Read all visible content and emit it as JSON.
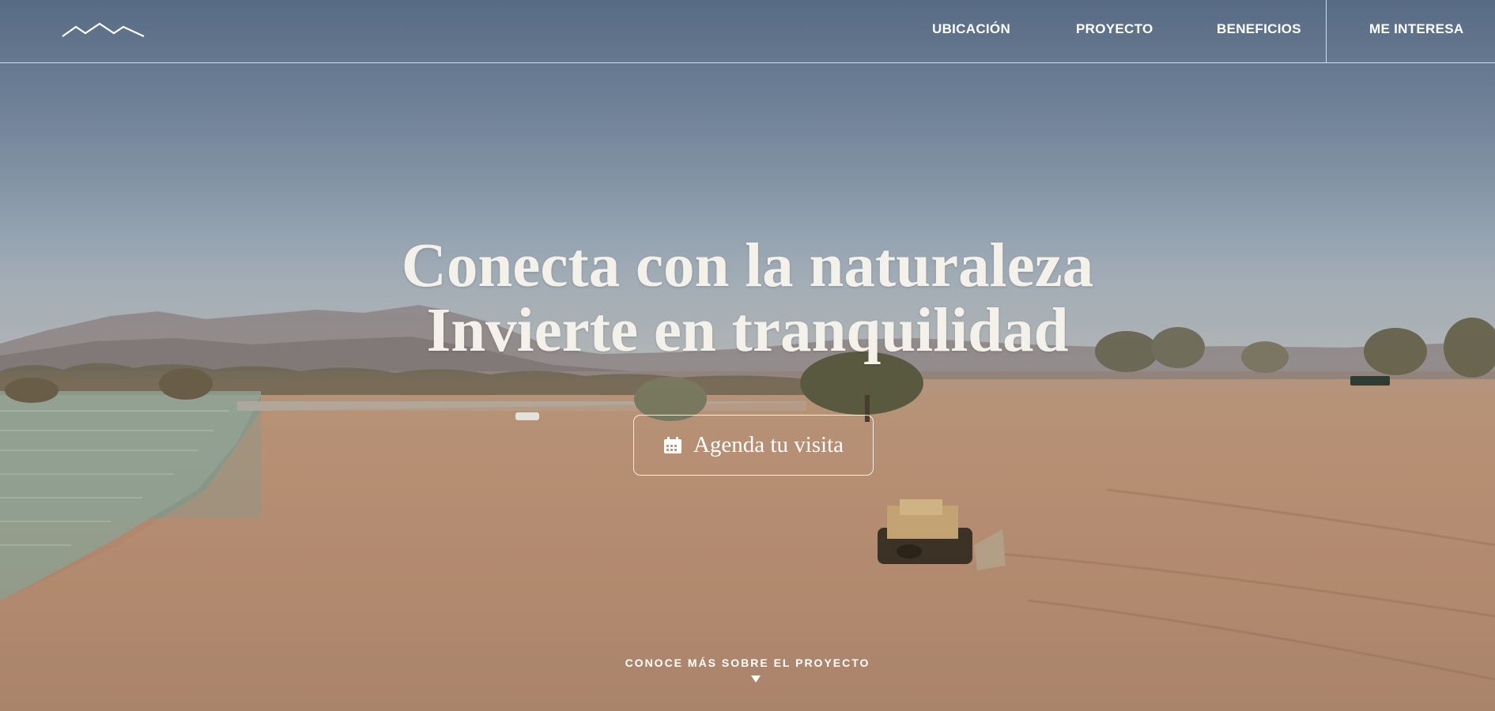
{
  "nav": {
    "items": [
      {
        "label": "UBICACIÓN"
      },
      {
        "label": "PROYECTO"
      },
      {
        "label": "BENEFICIOS"
      }
    ],
    "cta_label": "ME INTERESA"
  },
  "hero": {
    "headline_line1": "Conecta con la naturaleza",
    "headline_line2": "Invierte en tranquilidad",
    "cta_label": "Agenda tu visita",
    "cta_icon": "calendar-icon",
    "scroll_label": "CONOCE MÁS SOBRE EL PROYECTO",
    "scroll_icon": "caret-down-icon"
  },
  "logo": {
    "icon": "mountain-logo-icon"
  }
}
